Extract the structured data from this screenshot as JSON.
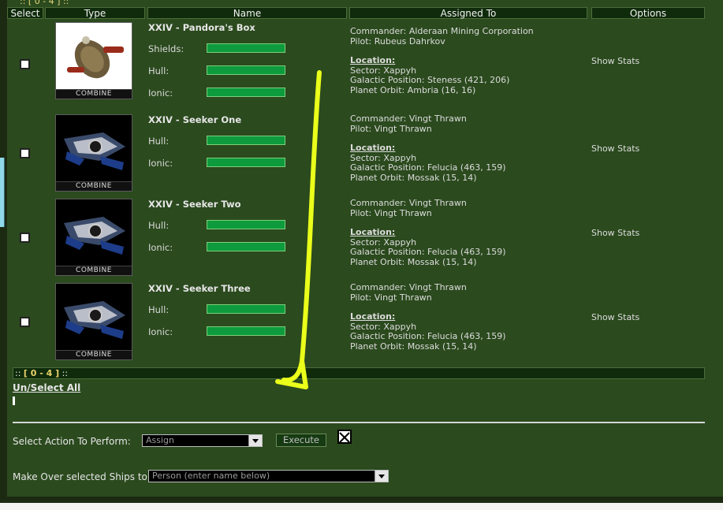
{
  "top_pager": "::  [ 0 - 4 ]  ::",
  "headers": {
    "select": "Select",
    "type": "Type",
    "name": "Name",
    "assigned": "Assigned To",
    "options": "Options"
  },
  "ships": [
    {
      "name": "XXIV - Pandora's Box",
      "image": "combine-slave-ship",
      "stats": [
        {
          "label": "Shields:",
          "value": 1.0
        },
        {
          "label": "Hull:",
          "value": 1.0
        },
        {
          "label": "Ionic:",
          "value": 1.0
        }
      ],
      "commander": "Commander: Alderaan Mining Corporation",
      "pilot": "Pilot: Rubeus Dahrkov",
      "location_label": "Location:",
      "sector": "Sector: Xappyh",
      "galactic": "Galactic Position: Steness (421, 206)",
      "orbit": "Planet Orbit: Ambria (16, 16)",
      "option": "Show Stats",
      "caption": "COMBINE"
    },
    {
      "name": "XXIV - Seeker One",
      "image": "combine-interceptor",
      "stats": [
        {
          "label": "Hull:",
          "value": 1.0
        },
        {
          "label": "Ionic:",
          "value": 1.0
        }
      ],
      "commander": "Commander: Vingt Thrawn",
      "pilot": "Pilot: Vingt Thrawn",
      "location_label": "Location:",
      "sector": "Sector: Xappyh",
      "galactic": "Galactic Position: Felucia (463, 159)",
      "orbit": "Planet Orbit: Mossak (15, 14)",
      "option": "Show Stats",
      "caption": "COMBINE"
    },
    {
      "name": "XXIV - Seeker Two",
      "image": "combine-interceptor",
      "stats": [
        {
          "label": "Hull:",
          "value": 1.0
        },
        {
          "label": "Ionic:",
          "value": 1.0
        }
      ],
      "commander": "Commander: Vingt Thrawn",
      "pilot": "Pilot: Vingt Thrawn",
      "location_label": "Location:",
      "sector": "Sector: Xappyh",
      "galactic": "Galactic Position: Felucia (463, 159)",
      "orbit": "Planet Orbit: Mossak (15, 14)",
      "option": "Show Stats",
      "caption": "COMBINE"
    },
    {
      "name": "XXIV - Seeker Three",
      "image": "combine-interceptor",
      "stats": [
        {
          "label": "Hull:",
          "value": 1.0
        },
        {
          "label": "Ionic:",
          "value": 1.0
        }
      ],
      "commander": "Commander: Vingt Thrawn",
      "pilot": "Pilot: Vingt Thrawn",
      "location_label": "Location:",
      "sector": "Sector: Xappyh",
      "galactic": "Galactic Position: Felucia (463, 159)",
      "orbit": "Planet Orbit: Mossak (15, 14)",
      "option": "Show Stats",
      "caption": "COMBINE"
    }
  ],
  "pager": {
    "prefix": "::",
    "range": "[ 0 - 4 ]",
    "suffix": "::"
  },
  "unselect_all": "Un/Select All",
  "action": {
    "label": "Select Action To Perform:",
    "selected": "Assign",
    "execute": "Execute"
  },
  "makeover": {
    "label": "Make Over selected Ships to:",
    "selected": "Person (enter name below)"
  },
  "colors": {
    "panel": "#2b4a1e",
    "header": "#0f2b0b",
    "bar": "#0d9b3d",
    "annotation_arrow": "#eaff1a"
  }
}
